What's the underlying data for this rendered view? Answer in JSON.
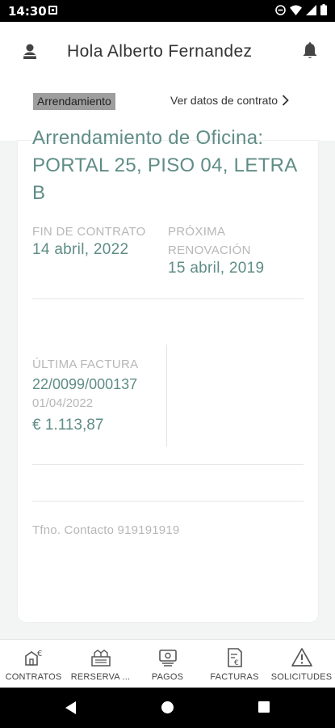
{
  "status_bar": {
    "time": "14:30",
    "icons": [
      "notification-icon",
      "dnd-icon",
      "wifi-icon",
      "signal-icon",
      "battery-icon"
    ]
  },
  "header": {
    "greeting": "Hola Alberto Fernandez",
    "icons": [
      "user-icon",
      "bell-icon"
    ]
  },
  "contract": {
    "type_label": "Arrendamiento",
    "view_link": "Ver datos de contrato",
    "title": "Arrendamiento de Oficina: PORTAL 25, PISO 04, LETRA B",
    "end_label": "FIN DE CONTRATO",
    "end_date": "14 abril, 2022",
    "renewal_label": "PRÓXIMA RENOVACIÓN",
    "renewal_date": "15 abril, 2019"
  },
  "invoice": {
    "label": "ÚLTIMA FACTURA",
    "number": "22/0099/000137",
    "date": "01/04/2022",
    "amount": "€ 1.113,87"
  },
  "contact": {
    "text": "Tfno. Contacto 919191919"
  },
  "bottom_nav": {
    "items": [
      {
        "label": "CONTRATOS",
        "icon": "contracts-icon"
      },
      {
        "label": "RERSERVA ...",
        "icon": "reservation-icon"
      },
      {
        "label": "PAGOS",
        "icon": "payments-icon"
      },
      {
        "label": "FACTURAS",
        "icon": "invoices-icon"
      },
      {
        "label": "SOLICITUDES",
        "icon": "requests-icon"
      }
    ]
  },
  "colors": {
    "accent": "#5f8d86",
    "muted_text": "#b7b7b7",
    "chip_background": "#9e9e9e"
  }
}
